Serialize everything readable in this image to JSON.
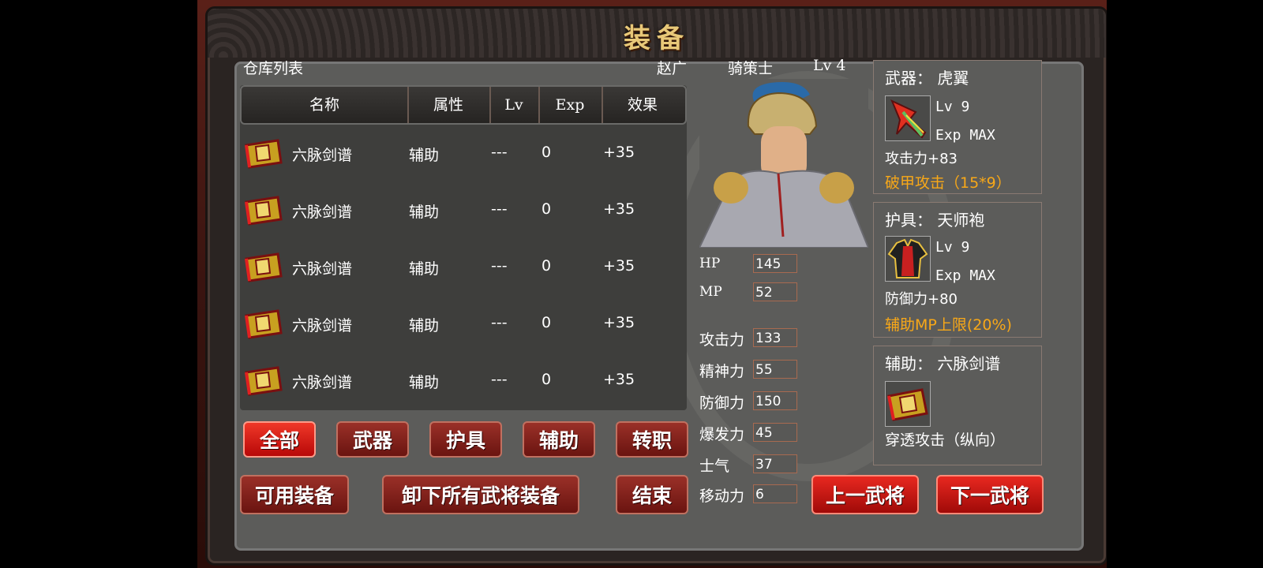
{
  "title": "装备",
  "header": {
    "warehouse_label": "仓库列表",
    "general_name": "赵广",
    "general_class": "骑策士",
    "general_level": "Lv 4"
  },
  "table": {
    "columns": [
      "名称",
      "属性",
      "Lv",
      "Exp",
      "效果"
    ],
    "rows": [
      {
        "icon": "book-icon",
        "name": "六脉剑谱",
        "attr": "辅助",
        "lv": "---",
        "exp": "0",
        "effect": "+35"
      },
      {
        "icon": "book-icon",
        "name": "六脉剑谱",
        "attr": "辅助",
        "lv": "---",
        "exp": "0",
        "effect": "+35"
      },
      {
        "icon": "book-icon",
        "name": "六脉剑谱",
        "attr": "辅助",
        "lv": "---",
        "exp": "0",
        "effect": "+35"
      },
      {
        "icon": "book-icon",
        "name": "六脉剑谱",
        "attr": "辅助",
        "lv": "---",
        "exp": "0",
        "effect": "+35"
      },
      {
        "icon": "book-icon",
        "name": "六脉剑谱",
        "attr": "辅助",
        "lv": "---",
        "exp": "0",
        "effect": "+35"
      }
    ]
  },
  "filters": {
    "all": "全部",
    "weapon": "武器",
    "armor": "护具",
    "assist": "辅助",
    "job_change": "转职"
  },
  "actions": {
    "usable": "可用装备",
    "unequip_all": "卸下所有武将装备",
    "end": "结束",
    "prev_general": "上一武将",
    "next_general": "下一武将"
  },
  "stats": [
    {
      "label": "HP",
      "value": "145"
    },
    {
      "label": "MP",
      "value": "52"
    },
    {
      "label": "攻击力",
      "value": "133"
    },
    {
      "label": "精神力",
      "value": "55"
    },
    {
      "label": "防御力",
      "value": "150"
    },
    {
      "label": "爆发力",
      "value": "45"
    },
    {
      "label": "士气",
      "value": "37"
    },
    {
      "label": "移动力",
      "value": "6"
    }
  ],
  "equipment": {
    "weapon": {
      "title": "武器： 虎翼",
      "lv": "Lv  9",
      "exp": "Exp  MAX",
      "bonus": "攻击力+83",
      "skill": "破甲攻击（15*9）",
      "icon": "sword-icon"
    },
    "armor": {
      "title": "护具： 天师袍",
      "lv": "Lv  9",
      "exp": "Exp  MAX",
      "bonus": "防御力+80",
      "skill": "辅助MP上限(20%)",
      "icon": "robe-icon"
    },
    "assist": {
      "title": "辅助： 六脉剑谱",
      "skill": "穿透攻击（纵向）",
      "icon": "book-icon"
    }
  },
  "colors": {
    "accent_red": "#e82820",
    "gold_title": "#e8c878",
    "skill_orange": "#f8a818"
  }
}
